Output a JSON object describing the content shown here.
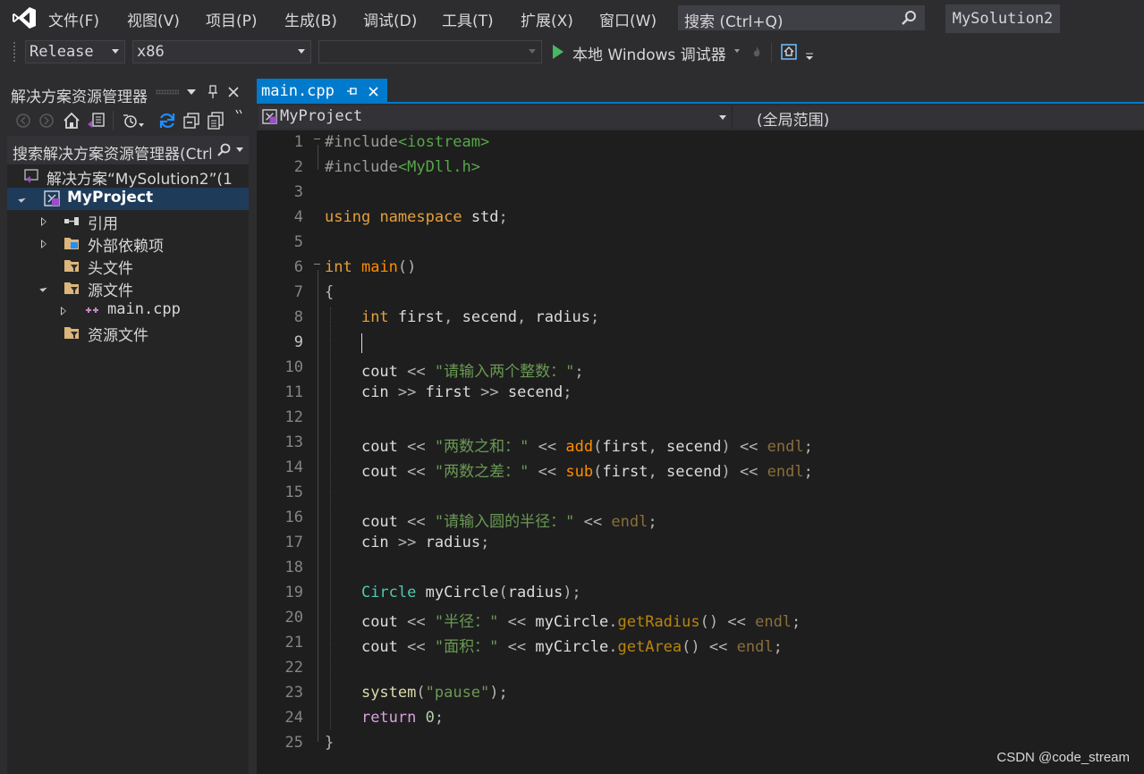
{
  "menubar": {
    "items": [
      "文件(F)",
      "视图(V)",
      "项目(P)",
      "生成(B)",
      "调试(D)",
      "工具(T)",
      "扩展(X)",
      "窗口(W)"
    ],
    "search_placeholder": "搜索 (Ctrl+Q)",
    "solution_name": "MySolution2"
  },
  "toolbar": {
    "configuration": "Release",
    "platform": "x86",
    "startup_item": "",
    "debugger_label": "本地 Windows 调试器"
  },
  "solution_explorer": {
    "title": "解决方案资源管理器",
    "search_placeholder": "搜索解决方案资源管理器(Ctrl+;)",
    "tree": [
      {
        "label": "解决方案“MySolution2”(1",
        "icon": "solution-icon"
      },
      {
        "label": "MyProject",
        "icon": "cpp-project-icon",
        "selected": true
      },
      {
        "label": "引用",
        "icon": "references-icon"
      },
      {
        "label": "外部依赖项",
        "icon": "folder-icon"
      },
      {
        "label": "头文件",
        "icon": "filter-folder-icon"
      },
      {
        "label": "源文件",
        "icon": "filter-folder-icon"
      },
      {
        "label": "main.cpp",
        "icon": "cpp-file-icon"
      },
      {
        "label": "资源文件",
        "icon": "filter-folder-icon"
      }
    ]
  },
  "editor": {
    "tab_label": "main.cpp",
    "project_scope": "MyProject",
    "member_scope": "(全局范围)",
    "line_numbers": [
      "1",
      "2",
      "3",
      "4",
      "5",
      "6",
      "7",
      "8",
      "9",
      "10",
      "11",
      "12",
      "13",
      "14",
      "15",
      "16",
      "17",
      "18",
      "19",
      "20",
      "21",
      "22",
      "23",
      "24",
      "25"
    ],
    "lines": [
      "#include<iostream>",
      "#include<MyDll.h>",
      "",
      "using namespace std;",
      "",
      "int main()",
      "{",
      "    int first, secend, radius;",
      "    ",
      "    cout << \"请输入两个整数：\";",
      "    cin >> first >> secend;",
      "",
      "    cout << \"两数之和：\" << add(first, secend) << endl;",
      "    cout << \"两数之差：\" << sub(first, secend) << endl;",
      "",
      "    cout << \"请输入圆的半径：\" << endl;",
      "    cin >> radius;",
      "",
      "    Circle myCircle(radius);",
      "    cout << \"半径：\" << myCircle.getRadius() << endl;",
      "    cout << \"面积：\" << myCircle.getArea() << endl;",
      "",
      "    system(\"pause\");",
      "    return 0;",
      "}"
    ]
  },
  "watermark": "CSDN @code_stream",
  "colors": {
    "accent": "#007acc",
    "selection": "#1f3b5a",
    "background": "#1e1e1e"
  }
}
